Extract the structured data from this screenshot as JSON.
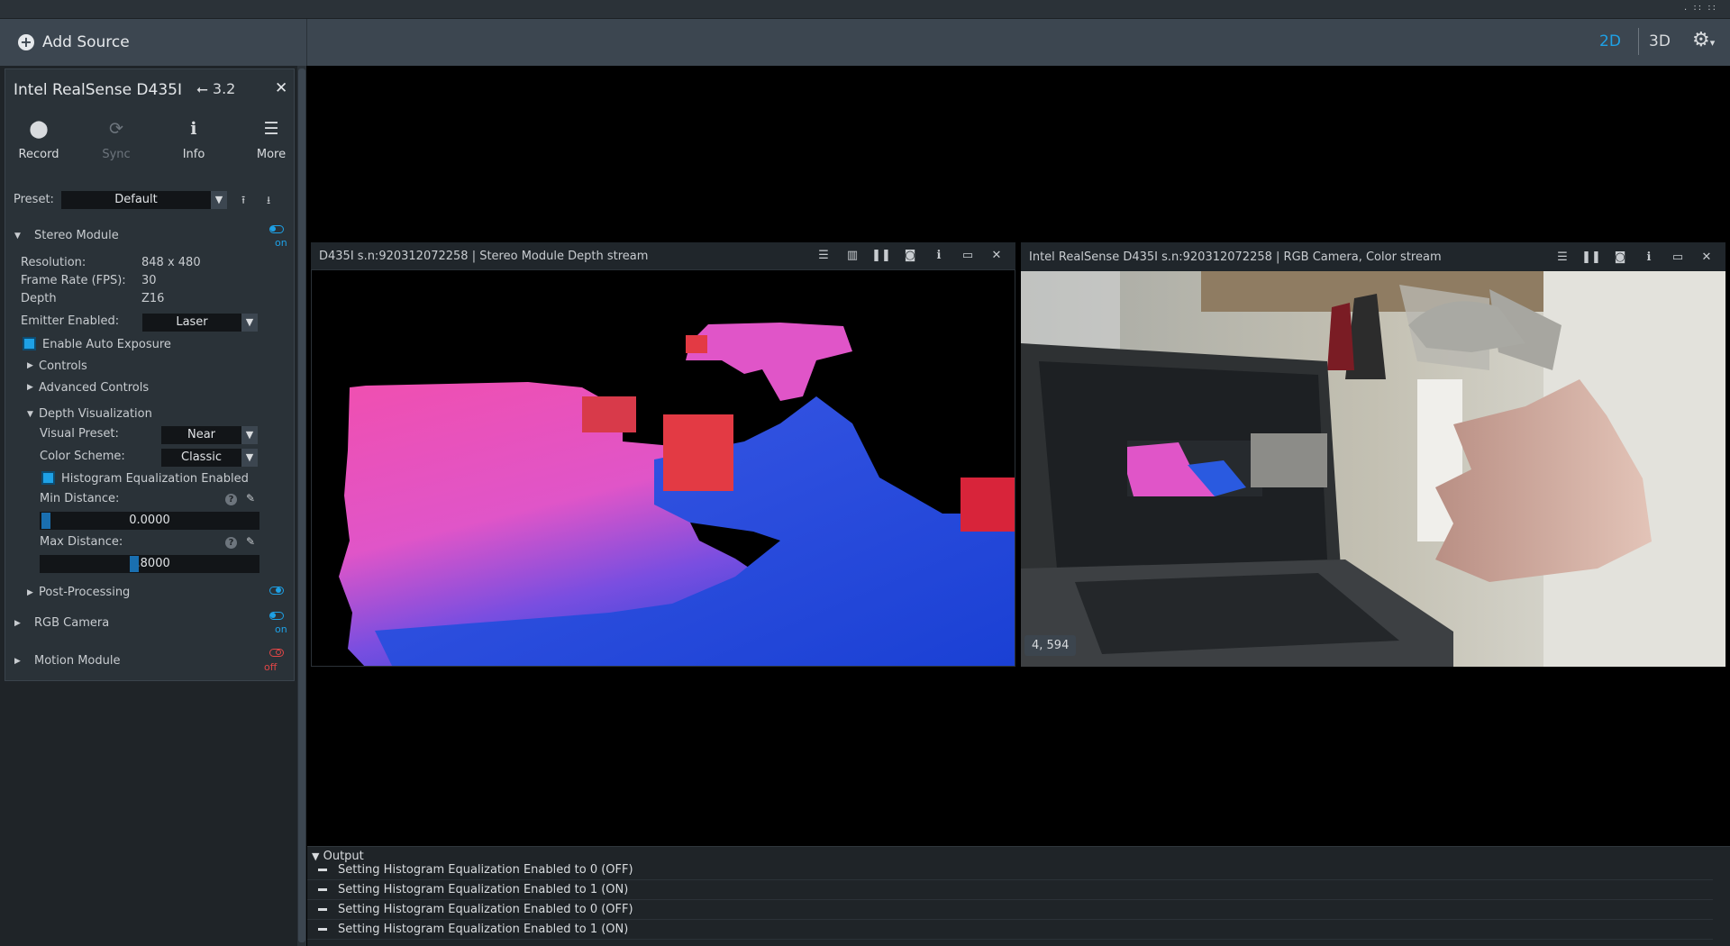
{
  "topbar": {
    "add_source": "Add Source",
    "view_2d": "2D",
    "view_3d": "3D",
    "colors": {
      "accent": "#1ea1e6",
      "off": "#e04646"
    }
  },
  "device": {
    "name": "Intel RealSense D435I",
    "usb_version": "3.2",
    "toolbar": [
      {
        "label": "Record",
        "icon": "record-icon",
        "enabled": true
      },
      {
        "label": "Sync",
        "icon": "sync-icon",
        "enabled": false
      },
      {
        "label": "Info",
        "icon": "info-icon",
        "enabled": true
      },
      {
        "label": "More",
        "icon": "menu-icon",
        "enabled": true
      }
    ],
    "preset_label": "Preset:",
    "preset_value": "Default"
  },
  "stereo": {
    "title": "Stereo Module",
    "toggle": "on",
    "resolution_label": "Resolution:",
    "resolution_value": "848 x 480",
    "fps_label": "Frame Rate (FPS):",
    "fps_value": "30",
    "depth_label": "Depth",
    "depth_value": "Z16",
    "emitter_label": "Emitter Enabled:",
    "emitter_value": "Laser",
    "auto_exposure": "Enable Auto Exposure",
    "controls": "Controls",
    "advanced": "Advanced Controls",
    "depth_vis": "Depth Visualization",
    "visual_preset_label": "Visual Preset:",
    "visual_preset_value": "Near",
    "color_scheme_label": "Color Scheme:",
    "color_scheme_value": "Classic",
    "histogram": "Histogram Equalization Enabled",
    "min_label": "Min Distance:",
    "min_value": "0.0000",
    "max_label": "Max Distance:",
    "max_value": "6.8000",
    "post_processing": "Post-Processing"
  },
  "rgb_camera": {
    "title": "RGB Camera",
    "toggle": "on"
  },
  "motion": {
    "title": "Motion Module",
    "toggle": "off"
  },
  "streams": {
    "depth_title": "D435I s.n:920312072258 | Stereo Module Depth stream",
    "rgb_title": "Intel RealSense D435I s.n:920312072258 | RGB Camera, Color stream",
    "coord": "4, 594"
  },
  "output": {
    "title": "Output",
    "logs": [
      "Setting Histogram Equalization Enabled to 0 (OFF)",
      "Setting Histogram Equalization Enabled to 1 (ON)",
      "Setting Histogram Equalization Enabled to 0 (OFF)",
      "Setting Histogram Equalization Enabled to 1 (ON)"
    ]
  }
}
